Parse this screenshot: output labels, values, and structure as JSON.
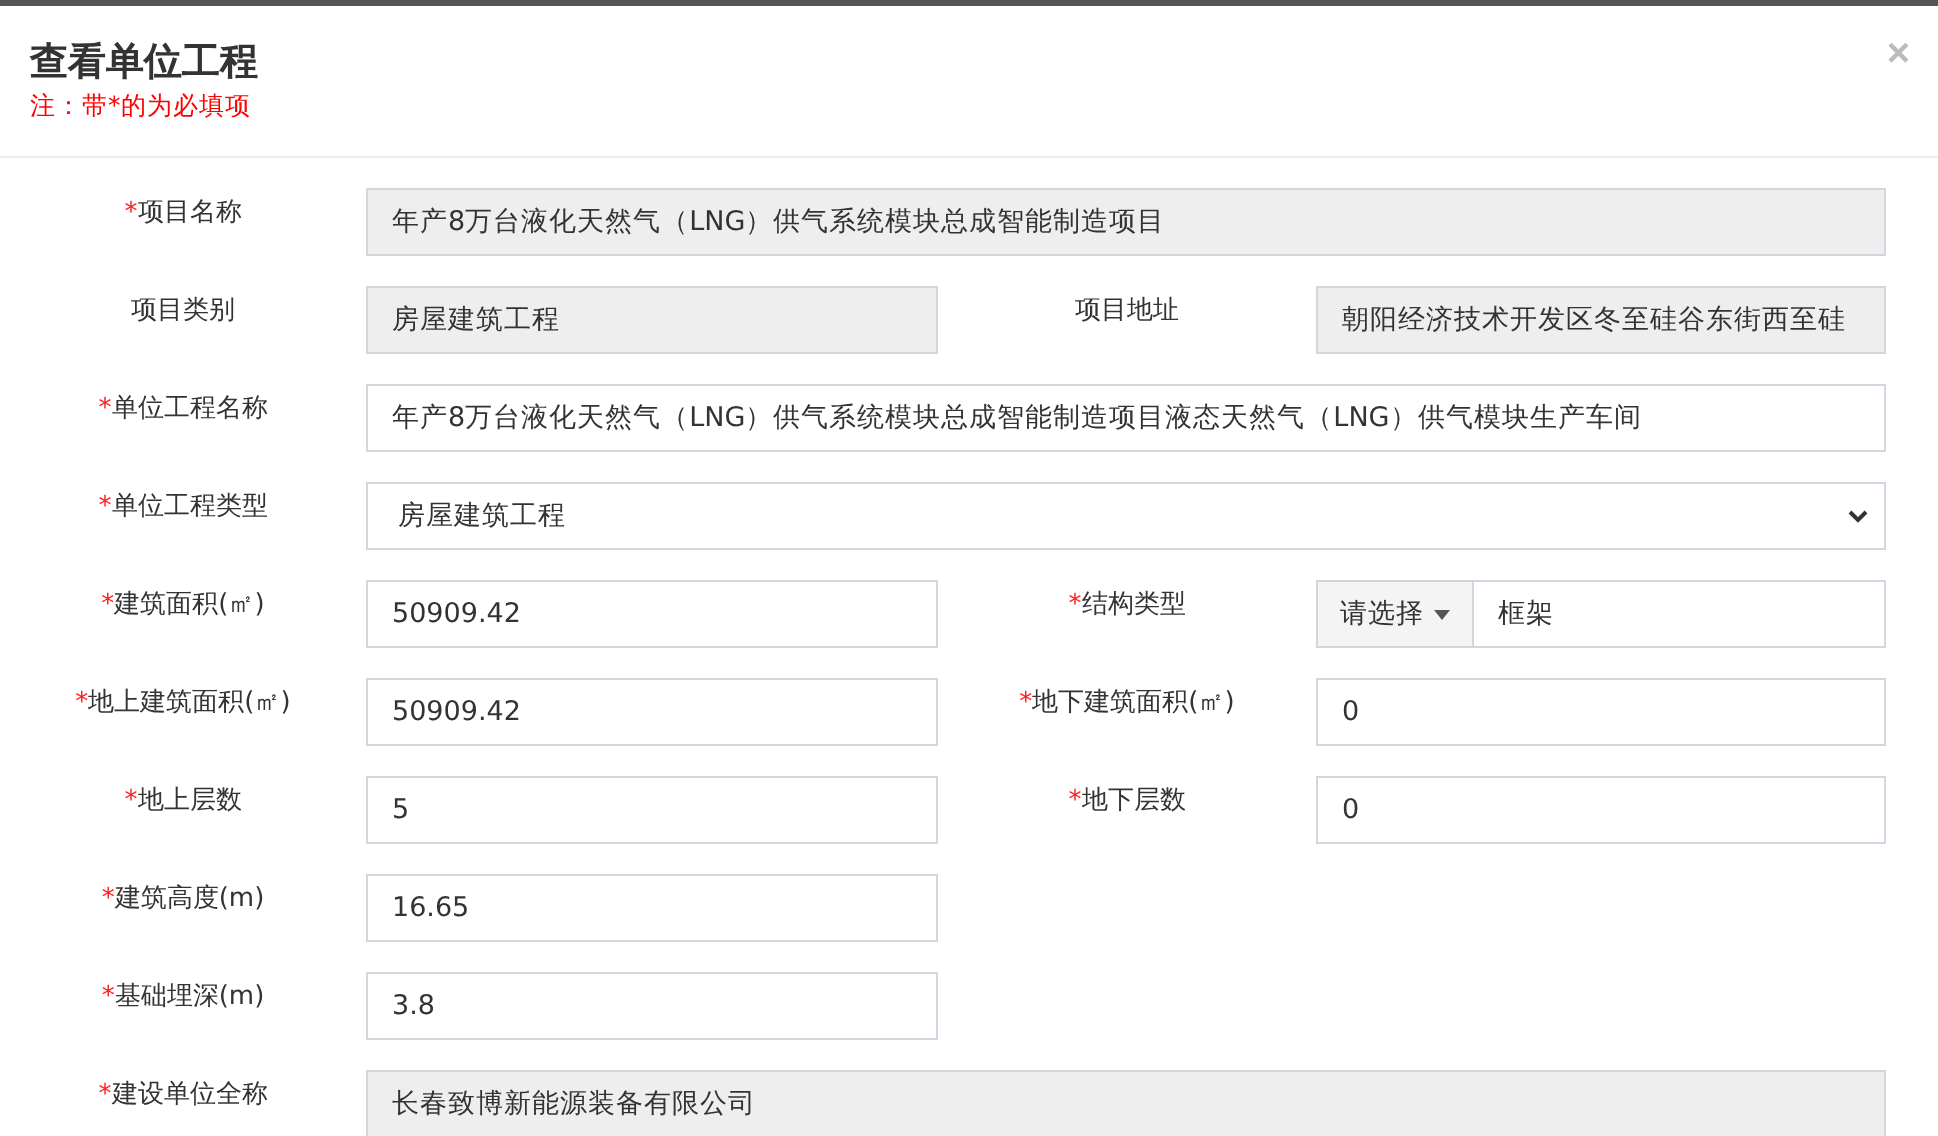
{
  "dialog": {
    "title": "查看单位工程",
    "note": "注：带*的为必填项",
    "close": "×"
  },
  "rows": [
    [
      {
        "mark": "*",
        "label": "项目名称",
        "kind": "text",
        "readonly": true,
        "wide": true,
        "value": "年产8万台液化天然气（LNG）供气系统模块总成智能制造项目"
      }
    ],
    [
      {
        "label": "项目类别",
        "kind": "text",
        "readonly": true,
        "wide": false,
        "value": "房屋建筑工程"
      },
      {
        "label": "项目地址",
        "kind": "text",
        "readonly": true,
        "wide": false,
        "value": "朝阳经济技术开发区冬至硅谷东街西至硅"
      }
    ],
    [
      {
        "mark": "*",
        "label": "单位工程名称",
        "kind": "text",
        "readonly": false,
        "wide": true,
        "value": "年产8万台液化天然气（LNG）供气系统模块总成智能制造项目液态天然气（LNG）供气模块生产车间"
      }
    ],
    [
      {
        "mark": "*",
        "label": "单位工程类型",
        "kind": "select",
        "readonly": false,
        "wide": true,
        "value": "房屋建筑工程"
      }
    ],
    [
      {
        "mark": "*",
        "label": "建筑面积(㎡)",
        "kind": "text",
        "readonly": false,
        "wide": false,
        "value": "50909.42"
      },
      {
        "mark": "*",
        "label": "结构类型",
        "kind": "addon",
        "readonly": false,
        "wide": false,
        "addon": "请选择",
        "value": "框架"
      }
    ],
    [
      {
        "mark": "*",
        "label": "地上建筑面积(㎡)",
        "kind": "text",
        "readonly": false,
        "wide": false,
        "value": "50909.42"
      },
      {
        "mark": "*",
        "label": "地下建筑面积(㎡)",
        "kind": "text",
        "readonly": false,
        "wide": false,
        "value": "0"
      }
    ],
    [
      {
        "mark": "*",
        "label": "地上层数",
        "kind": "text",
        "readonly": false,
        "wide": false,
        "value": "5"
      },
      {
        "mark": "*",
        "label": "地下层数",
        "kind": "text",
        "readonly": false,
        "wide": false,
        "value": "0"
      }
    ],
    [
      {
        "mark": "*",
        "label": "建筑高度(m)",
        "kind": "text",
        "readonly": false,
        "wide": false,
        "value": "16.65"
      }
    ],
    [
      {
        "mark": "*",
        "label": "基础埋深(m)",
        "kind": "text",
        "readonly": false,
        "wide": false,
        "value": "3.8"
      }
    ],
    [
      {
        "mark": "*",
        "label": "建设单位全称",
        "kind": "text",
        "readonly": true,
        "wide": true,
        "value": "长春致博新能源装备有限公司"
      }
    ]
  ]
}
